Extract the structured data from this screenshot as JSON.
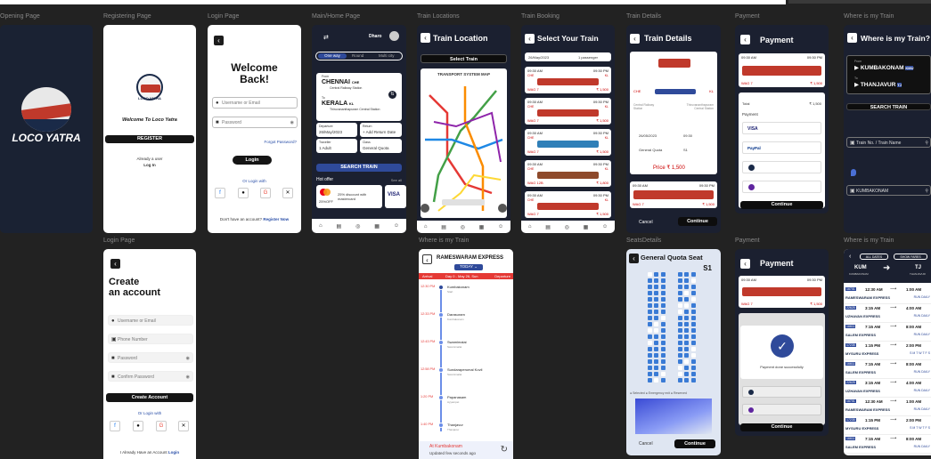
{
  "labels": {
    "opening": "Opening Page",
    "registering": "Registering Page",
    "login": "Login Page",
    "main": "Main/Home Page",
    "locations": "Train Locations",
    "booking": "Train Booking",
    "details": "Train Details",
    "payment": "Payment",
    "where": "Where is my Train",
    "login2": "Login Page",
    "where2": "Where is my Train",
    "seats": "SeatsDetails",
    "payment2": "Payment",
    "where3": "Where is my Train"
  },
  "opening": {
    "brand": "LOCO YATRA"
  },
  "register": {
    "logo_text": "LOCO YATRA",
    "welcome": "Welcome To",
    "brand": "Loco Yatra",
    "register_button": "REGISTER",
    "already": "Already a user",
    "login_link": "Log In"
  },
  "login": {
    "title_line1": "Welcome",
    "title_line2": "Back!",
    "username_ph": "Username or Email",
    "password_ph": "Password",
    "forgot": "Forgot Password?",
    "login_button": "Login",
    "or": "Or Login with",
    "signup_text": "Don't have an account?",
    "signup_link": "Register Now"
  },
  "home": {
    "user": "Dharo",
    "tab_oneway": "One way",
    "tab_round": "Round",
    "tab_multi": "Multi city",
    "from_label": "From",
    "from_city": "CHENNAI",
    "from_code": "CHE",
    "from_station": "Central Railway Station",
    "to_label": "To",
    "to_city": "KERALA",
    "to_code": "KL",
    "to_station": "Thiruvananthapuram Central Station",
    "departure_label": "Departure",
    "departure": "26/May/2023",
    "return_label": "Return",
    "return": "+ Add Return Date",
    "traveller_label": "Traveller",
    "traveller": "1 Adult",
    "class_label": "Class",
    "class": "General Quota",
    "search_button": "SEARCH TRAIN",
    "hot_offer": "Hot offer",
    "see_all": "See all",
    "offer1_pct": "25%OFF",
    "offer1_text": "25% discount with mastercard",
    "offer2_brand": "VISA",
    "nav": [
      "Home",
      "Booking",
      "RU",
      "Plan",
      "Profile"
    ]
  },
  "location": {
    "title": "Train Location",
    "select_button": "Select Train",
    "map_title": "TRANSPORT SYSTEM MAP"
  },
  "booking": {
    "title": "Select Your Train",
    "date": "26/May/2023",
    "pass": "1 passenger",
    "rows": [
      {
        "dep": "09:30 AM",
        "arr": "09:30 PM",
        "from": "CHE",
        "to": "KL",
        "cls": "WAG 7",
        "price": "₹ 1,500"
      },
      {
        "dep": "09:30 AM",
        "arr": "09:30 PM",
        "from": "CHE",
        "to": "KL",
        "cls": "WAG 7",
        "price": "₹ 1,500"
      },
      {
        "dep": "09:30 AM",
        "arr": "09:30 PM",
        "from": "CHE",
        "to": "KL",
        "cls": "WAG 7",
        "price": "₹ 1,500"
      },
      {
        "dep": "09:30 AM",
        "arr": "09:30 PM",
        "from": "CHE",
        "to": "KL",
        "cls": "WAG 12B",
        "price": "₹ 1,800"
      },
      {
        "dep": "09:30 AM",
        "arr": "09:30 PM",
        "from": "CHE",
        "to": "KL",
        "cls": "WAG 7",
        "price": "₹ 1,500"
      }
    ]
  },
  "details": {
    "title": "Train Details",
    "from": "CHE",
    "to": "KL",
    "from_station": "Central Railway Station",
    "to_station": "Thiruvananthapuram Central Station",
    "date": "26/05/2023",
    "time": "09:30",
    "quota": "General Quota",
    "seat": "S1",
    "price": "Price ₹ 1,500",
    "cancel": "Cancel",
    "continue": "Continue",
    "dep": "09:30 AM",
    "arr": "09:30 PM",
    "cls": "WAG 7",
    "fare": "₹ 1,500"
  },
  "payment": {
    "title": "Payment",
    "dep": "09:30 AM",
    "arr": "09:30 PM",
    "cls": "WAG 7",
    "fare": "₹ 1,500",
    "total_label": "Total",
    "total": "₹ 1,500",
    "payment_label": "Payment",
    "visa": "VISA",
    "paypal": "PayPal",
    "continue": "Continue"
  },
  "where": {
    "title": "Where is my Train?",
    "from_label": "From",
    "from": "KUMBAKONAM",
    "from_code": "KMU",
    "to_label": "To",
    "to": "THANJAVUR",
    "to_code": "TJ",
    "search_button": "SEARCH TRAIN",
    "train_ph": "Train No. / Train Name",
    "station": "KUMBAKONAM"
  },
  "create": {
    "title_line1": "Create",
    "title_line2": "an account",
    "username_ph": "Username or Email",
    "phone_ph": "Phone Number",
    "password_ph": "Password",
    "confirm_ph": "Confirm Password",
    "create_button": "Create Account",
    "or": "Or Login with",
    "already": "I Already Have an Account",
    "login_link": "Login"
  },
  "express": {
    "title": "RAMESWARAM EXPRESS",
    "today": "TODAY",
    "col_arrival": "Arrival",
    "col_day": "Day 0 - May 26, Sun",
    "col_departure": "Departure",
    "stops": [
      {
        "time": "12:30 PM",
        "name": "Kumbakonam",
        "sub": "Start"
      },
      {
        "time": "12:33 PM",
        "name": "Darasuram",
        "sub": "Kumbakonam"
      },
      {
        "time": "12:43 PM",
        "name": "Swamimalai",
        "sub": "Swamimalai"
      },
      {
        "time": "12:58 PM",
        "name": "Sundaraperumal Kovil",
        "sub": "Swamimalai"
      },
      {
        "time": "1:20 PM",
        "name": "Papanasam",
        "sub": "Ayyampet"
      },
      {
        "time": "1:40 PM",
        "name": "Thanjavur",
        "sub": "Thanjavur"
      }
    ],
    "at": "At Kumbakonam",
    "updated": "Updated few seconds ago"
  },
  "seats": {
    "title": "General Quota Seat",
    "coach": "S1",
    "legend1": "Selected",
    "legend2": "Emergency exit",
    "legend3": "Reserved",
    "cancel": "Cancel",
    "continue": "Continue"
  },
  "payment2": {
    "title": "Payment",
    "dep": "09:30 AM",
    "arr": "09:30 PM",
    "cls": "WAG 7",
    "fare": "₹ 1,500",
    "success": "Payment done successfully",
    "continue": "Continue"
  },
  "schedule": {
    "tab1": "ALL DATES",
    "tab2": "SHOW FARES",
    "from_code": "KUM",
    "from_name": "KUMBAKONAM",
    "to_code": "TJ",
    "to_name": "THANJAVUR",
    "rows": [
      {
        "no": "16701",
        "dep": "12:30 AM",
        "arr": "1:00 AM",
        "name": "RAMESWARAM EXPRESS",
        "days": "RUN DAILY"
      },
      {
        "no": "22625",
        "dep": "3:15 AM",
        "arr": "4:00 AM",
        "name": "UZHAVAN EXPRESS",
        "days": "RUN DAILY"
      },
      {
        "no": "16611",
        "dep": "7:15 AM",
        "arr": "8:00 AM",
        "name": "SALEM EXPRESS",
        "days": "RUN DAILY"
      },
      {
        "no": "17235",
        "dep": "1:15 PM",
        "arr": "2:00 PM",
        "name": "MYSURU EXPRESS",
        "days": "S M T W T F S"
      },
      {
        "no": "16611",
        "dep": "7:15 AM",
        "arr": "8:00 AM",
        "name": "SALEM EXPRESS",
        "days": "RUN DAILY"
      },
      {
        "no": "22625",
        "dep": "3:15 AM",
        "arr": "4:00 AM",
        "name": "UZHAVAN EXPRESS",
        "days": "RUN DAILY"
      },
      {
        "no": "16701",
        "dep": "12:30 AM",
        "arr": "1:00 AM",
        "name": "RAMESWARAM EXPRESS",
        "days": "RUN DAILY"
      },
      {
        "no": "17235",
        "dep": "1:15 PM",
        "arr": "2:00 PM",
        "name": "MYSURU EXPRESS",
        "days": "S M T W T F S"
      },
      {
        "no": "16611",
        "dep": "7:15 AM",
        "arr": "8:00 AM",
        "name": "SALEM EXPRESS",
        "days": "RUN DAILY"
      }
    ]
  }
}
